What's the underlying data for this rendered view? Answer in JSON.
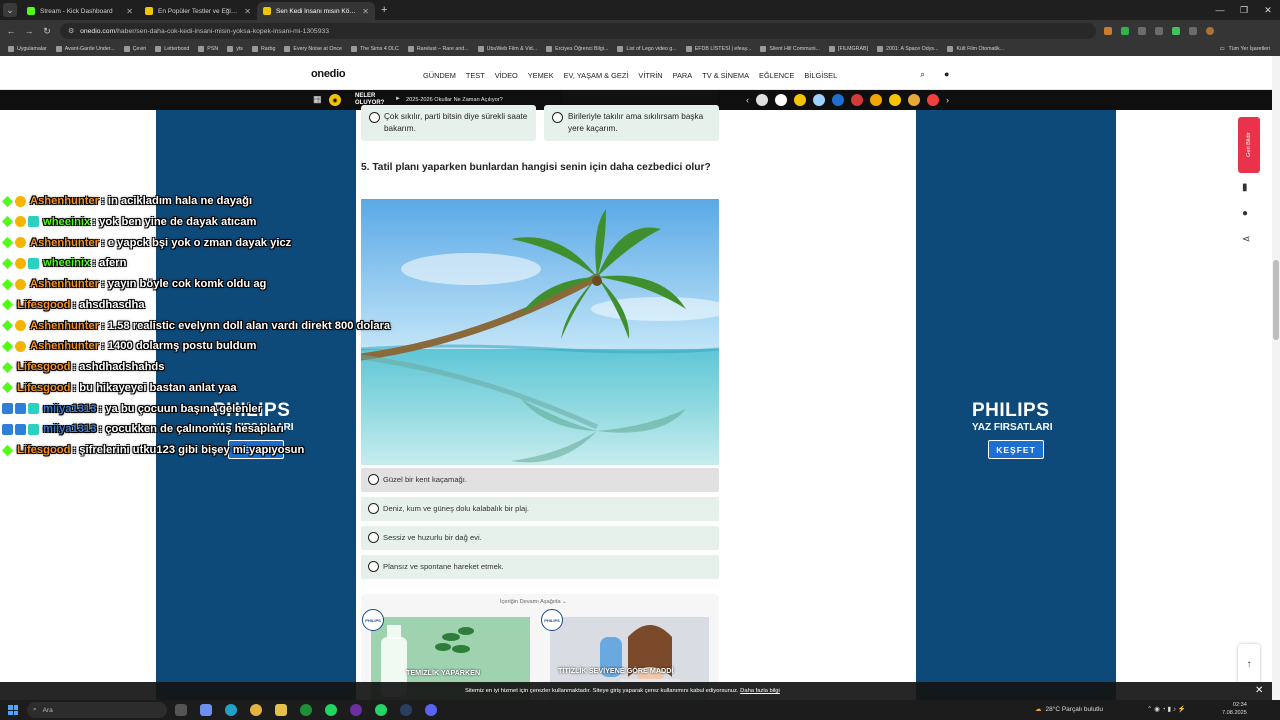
{
  "browser": {
    "tabs": [
      {
        "title": "Stream - Kick Dashboard",
        "color": "#53fc18"
      },
      {
        "title": "En Popüler Testler ve Eğlenceli",
        "color": "#f2c500"
      },
      {
        "title": "Sen Kedi İnsanı mısın Köpek İn",
        "color": "#f2c500"
      }
    ],
    "url_host": "onedio.com",
    "url_path": "/haber/sen-daha-cok-kedi-insani-misin-yoksa-kopek-insani-mi-1305933",
    "bookmarks": [
      "Uygulamalar",
      "Avant-Garde Under...",
      "Çeviri",
      "Letterboxd",
      "PSN",
      "yts",
      "Rarbg",
      "Every Noise at Once",
      "The Sims 4 DLC",
      "Rarelust – Rare and...",
      "UbuWeb Film & Vid...",
      "Erciyes Öğrenci Bilgi...",
      "List of Lego video g...",
      "EFDB LİSTESİ | efeay...",
      "Silent Hill Communi...",
      "[FILMGRAB]",
      "2001: A Space Odys...",
      "Kült Film Otomatik..."
    ],
    "bookmarks_right": "Tüm Yer İşaretleri"
  },
  "site": {
    "logo": "onedio",
    "nav": [
      "GÜNDEM",
      "TEST",
      "VİDEO",
      "YEMEK",
      "EV, YAŞAM & GEZİ",
      "VİTRİN",
      "PARA",
      "TV & SİNEMA",
      "EĞLENCE",
      "BİLGİSEL"
    ]
  },
  "trending": {
    "label_line1": "NELER",
    "label_line2": "OLUYOR?",
    "headline": "2025-2026 Okullar Ne Zaman Açılıyor?",
    "category_colors": [
      "#e0e0e0",
      "#ffffff",
      "#f5c400",
      "#9fd1ff",
      "#1f6fd0",
      "#d43a3a",
      "#f0a800",
      "#f7c600",
      "#e8a93b",
      "#f04040"
    ]
  },
  "prev_question": {
    "option_a": "Çok sıkılır, parti bitsin diye sürekli saate bakarım.",
    "option_b": "Birileriyle takılır ama sıkılırsam başka yere kaçarım."
  },
  "question": {
    "title": "5. Tatil planı yaparken bunlardan hangisi senin için daha cezbedici olur?",
    "answers": [
      "Güzel bir kent kaçamağı.",
      "Deniz, kum ve güneş dolu kalabalık bir plaj.",
      "Sessiz ve huzurlu bir dağ evi.",
      "Plansız ve spontane hareket etmek."
    ]
  },
  "continue": {
    "label": "İçeriğin Devamı Aşağıda",
    "card1_caption": "TEMİZLİK YAPARKEN",
    "card2_caption": "TİTİZLİK SEVİYENE GÖRE MADDİ",
    "badge": "PHILIPS"
  },
  "ads": {
    "brand": "PHILIPS",
    "tagline": "YAZ FIRSATLARI",
    "button": "KEŞFET"
  },
  "floating": {
    "feedback": "Geri Bildir"
  },
  "cookie": {
    "text": "Sitemiz en iyi hizmet için çerezler kullanmaktadır. Siteye giriş yaparak çerez kullanımını kabul ediyorsunuz.",
    "link": "Daha fazla bilgi"
  },
  "taskbar": {
    "search": "Ara",
    "weather": "28°C  Parçalı bulutlu",
    "time": "02:34",
    "date": "7.08.2025"
  },
  "chat": [
    {
      "user": "Ashenhunter",
      "user_color": "#f7931e",
      "badges": [
        "green",
        "gold"
      ],
      "text": ": in acikladım hala ne dayağı"
    },
    {
      "user": "wheeinix",
      "user_color": "#53fc18",
      "badges": [
        "green",
        "gold",
        "teal"
      ],
      "text": ": yok ben yine de dayak atıcam"
    },
    {
      "user": "Ashenhunter",
      "user_color": "#f7931e",
      "badges": [
        "green",
        "gold"
      ],
      "text": ": e yapck bşi yok o zman dayak yicz"
    },
    {
      "user": "wheeinix",
      "user_color": "#53fc18",
      "badges": [
        "green",
        "gold",
        "teal"
      ],
      "text": ": afern"
    },
    {
      "user": "Ashenhunter",
      "user_color": "#f7931e",
      "badges": [
        "green",
        "gold"
      ],
      "text": ": yayın böyle cok komk oldu ag"
    },
    {
      "user": "Lifesgood",
      "user_color": "#f7931e",
      "badges": [
        "green"
      ],
      "text": ": ahsdhasdha"
    },
    {
      "user": "Ashenhunter",
      "user_color": "#f7931e",
      "badges": [
        "green",
        "gold"
      ],
      "text": ": 1.58 realistic evelynn doll alan vardı direkt 800 dolara"
    },
    {
      "user": "Ashenhunter",
      "user_color": "#f7931e",
      "badges": [
        "green",
        "gold"
      ],
      "text": ": 1400 dolarmş postu buldum"
    },
    {
      "user": "Lifesgood",
      "user_color": "#f7931e",
      "badges": [
        "green"
      ],
      "text": ": ashdhadshahds"
    },
    {
      "user": "Lifesgood",
      "user_color": "#f7931e",
      "badges": [
        "green"
      ],
      "text": ": bu hikayeyei bastan anlat yaa"
    },
    {
      "user": "miiya1313",
      "user_color": "#3a7bd5",
      "badges": [
        "blue",
        "blue",
        "teal"
      ],
      "text": ": ya bu çocuun başına gelenler"
    },
    {
      "user": "miiya1313",
      "user_color": "#3a7bd5",
      "badges": [
        "blue",
        "blue",
        "teal"
      ],
      "text": ": çocukken de çalınomuş hesapları"
    },
    {
      "user": "Lifesgood",
      "user_color": "#f7931e",
      "badges": [
        "green"
      ],
      "text": ": şifrelerini utku123 gibi bişey mi yapıyosun"
    }
  ]
}
